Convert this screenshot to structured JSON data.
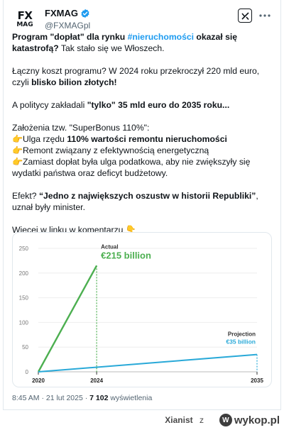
{
  "account": {
    "avatar_line1": "FX",
    "avatar_line2": "MAG",
    "name": "FXMAG",
    "handle": "@FXMAGpl"
  },
  "tweet": {
    "p1_bold1": "Program \"dopłat\" dla rynku ",
    "p1_hashtag": "#nieruchomości",
    "p1_bold2": " okazał się katastrofą?",
    "p1_rest": " Tak stało się we Włoszech.",
    "p2_text": "Łączny koszt programu? W 2024 roku przekroczył 220 mld euro, czyli ",
    "p2_bold": "blisko bilion złotych!",
    "p3_text": "A politycy zakładali ",
    "p3_bold": "\"tylko\" 35 mld euro do 2035 roku...",
    "p4_intro": "Założenia tzw. \"SuperBonus 110%\":",
    "p4_item1_text": "Ulga rzędu ",
    "p4_item1_bold": "110% wartości remontu nieruchomości",
    "p4_item2": "Remont związany z efektywnością energetyczną",
    "p4_item3": "Zamiast dopłat była ulga podatkowa, aby nie zwiększyły się wydatki państwa oraz deficyt budżetowy.",
    "p5_text": "Efekt? ",
    "p5_bold": "“Jedno z największych oszustw w historii Republiki”",
    "p5_rest": ", uznał były minister.",
    "p6_text": "Więcej w linku w komentarzu",
    "emoji_point": "👉",
    "emoji_down": "👇",
    "timestamp": "8:45 AM · 21 lut 2025 · ",
    "views_count": "7 102",
    "views_label": " wyświetlenia"
  },
  "chart_data": {
    "type": "line",
    "x_ticks": [
      "2020",
      "2024",
      "2035"
    ],
    "y_ticks": [
      "0",
      "50",
      "100",
      "150",
      "200",
      "250"
    ],
    "ylim": [
      0,
      250
    ],
    "series": [
      {
        "name": "Actual",
        "value_label": "€215 billion",
        "color": "#4caf50",
        "points": [
          [
            2020,
            0
          ],
          [
            2024,
            215
          ]
        ]
      },
      {
        "name": "Projection",
        "value_label": "€35 billion",
        "color": "#29a9d8",
        "points": [
          [
            2020,
            0
          ],
          [
            2035,
            35
          ]
        ]
      }
    ]
  },
  "footer": {
    "user": "Xianist",
    "separator": "z",
    "site": "wykop.pl",
    "site_mark": "W"
  }
}
